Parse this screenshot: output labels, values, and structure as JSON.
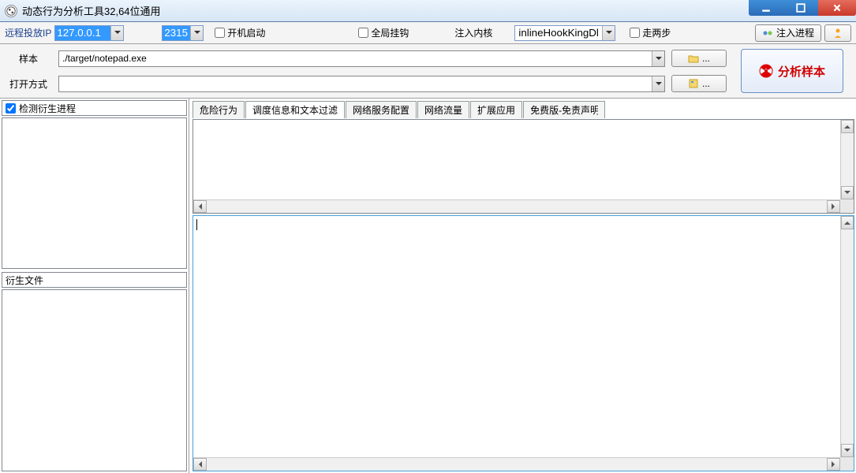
{
  "window": {
    "title": "动态行为分析工具32,64位通用"
  },
  "toolbar": {
    "remote_ip_label": "远程投放IP",
    "remote_ip_value": "127.0.0.1",
    "port_value": "2315",
    "autostart_label": "开机启动",
    "global_hook_label": "全局挂钩",
    "inject_kernel_label": "注入内核",
    "hook_method_value": "inlineHookKingDll",
    "two_step_label": "走两步",
    "inject_process_label": "注入进程"
  },
  "files": {
    "sample_label": "样本",
    "sample_value": "./target/notepad.exe",
    "open_with_label": "打开方式",
    "open_with_value": "",
    "browse_label": "...",
    "analyze_label": "分析样本"
  },
  "leftpanel": {
    "detect_spawn_label": "检测衍生进程",
    "derived_files_label": "衍生文件"
  },
  "tabs": {
    "items": [
      {
        "label": "危险行为"
      },
      {
        "label": "调度信息和文本过滤"
      },
      {
        "label": "网络服务配置"
      },
      {
        "label": "网络流量"
      },
      {
        "label": "扩展应用"
      },
      {
        "label": "免费版-免责声明"
      }
    ],
    "active_index": 1
  }
}
